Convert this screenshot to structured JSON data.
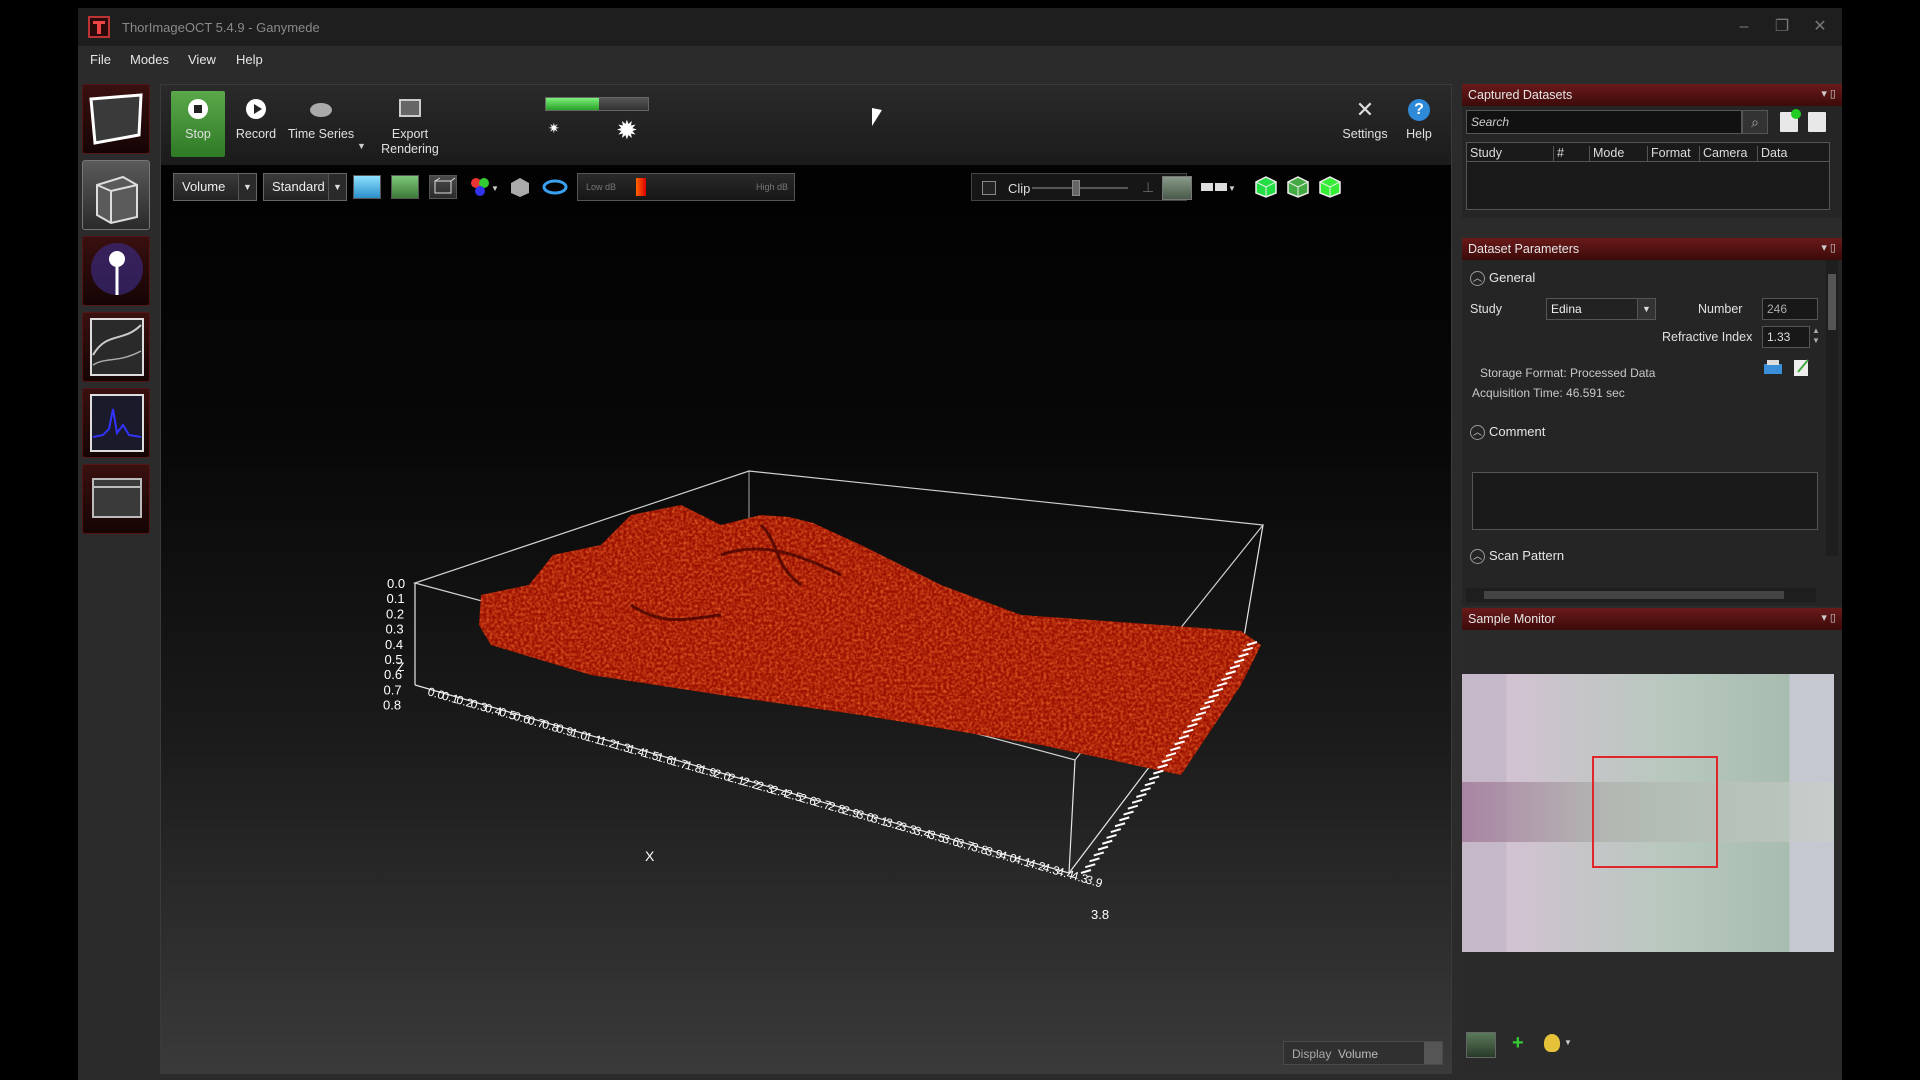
{
  "app": {
    "window_title": "ThorImageOCT 5.4.9 - Ganymede",
    "window_controls": [
      "–",
      "❐",
      "✕"
    ]
  },
  "menu": [
    "File",
    "Modes",
    "View",
    "Help"
  ],
  "toolbar": {
    "stop": "Stop",
    "record": "Record",
    "time_series": "Time Series",
    "export_line1": "Export",
    "export_line2": "Rendering",
    "settings": "Settings",
    "help": "Help",
    "brightness_level": 0.52
  },
  "render_controls": {
    "view_mode": "Volume",
    "preset": "Standard",
    "low_db": "Low dB",
    "high_db": "High dB",
    "clip": "Clip"
  },
  "plot": {
    "x_axis_label": "X",
    "z_axis_label": "Z",
    "z_ticks": [
      "0.0",
      "0.1",
      "0.2",
      "0.3",
      "0.4",
      "0.5",
      "0.6",
      "0.7",
      "0.8"
    ],
    "x_ticks": [
      "0.0",
      "0.1",
      "0.2",
      "0.3",
      "0.4",
      "0.5",
      "0.6",
      "0.7",
      "0.8",
      "0.9",
      "1.0",
      "1.1",
      "1.2",
      "1.3",
      "1.4",
      "1.5",
      "1.6",
      "1.7",
      "1.8",
      "1.9",
      "2.0",
      "2.1",
      "2.2",
      "2.3",
      "2.4",
      "2.5",
      "2.6",
      "2.7",
      "2.8",
      "2.9",
      "3.0",
      "3.1",
      "3.2",
      "3.3",
      "3.4",
      "3.5",
      "3.6",
      "3.7",
      "3.8",
      "3.9",
      "4.0",
      "4.1",
      "4.2",
      "4.3",
      "4.4",
      "4.3",
      "3.9"
    ],
    "y_corner_label": "3.8"
  },
  "display": {
    "label": "Display",
    "value": "Volume"
  },
  "captured_datasets": {
    "title": "Captured Datasets",
    "search_placeholder": "Search",
    "columns": [
      "Study",
      "#",
      "Mode",
      "Format",
      "Camera",
      "Data"
    ]
  },
  "dataset_parameters": {
    "title": "Dataset Parameters",
    "general": "General",
    "study_label": "Study",
    "study_value": "Edina",
    "number_label": "Number",
    "number_value": "246",
    "refractive_label": "Refractive Index",
    "refractive_value": "1.33",
    "storage_format": "Storage Format: Processed Data",
    "acquisition_time": "Acquisition Time: 46.591 sec",
    "comment": "Comment",
    "scan_pattern": "Scan Pattern"
  },
  "sample_monitor": {
    "title": "Sample Monitor"
  },
  "colors": {
    "accent_red": "#6a1a1a",
    "volume_red": "#c81e0a",
    "stop_green": "#4a9a3c"
  }
}
